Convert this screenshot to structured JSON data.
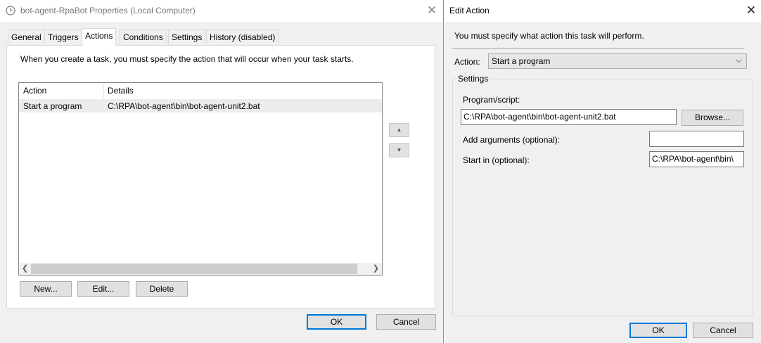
{
  "left_window": {
    "title": "bot-agent-RpaBot Properties (Local Computer)",
    "tabs": [
      "General",
      "Triggers",
      "Actions",
      "Conditions",
      "Settings",
      "History (disabled)"
    ],
    "active_tab": "Actions",
    "description": "When you create a task, you must specify the action that will occur when your task starts.",
    "table": {
      "columns": [
        "Action",
        "Details"
      ],
      "rows": [
        {
          "action": "Start a program",
          "details": "C:\\RPA\\bot-agent\\bin\\bot-agent-unit2.bat"
        }
      ]
    },
    "buttons": {
      "new": "New...",
      "edit": "Edit...",
      "delete": "Delete",
      "ok": "OK",
      "cancel": "Cancel"
    }
  },
  "right_window": {
    "title": "Edit Action",
    "instruction": "You must specify what action this task will perform.",
    "action_label": "Action:",
    "action_value": "Start a program",
    "settings_label": "Settings",
    "program_label": "Program/script:",
    "program_value": "C:\\RPA\\bot-agent\\bin\\bot-agent-unit2.bat",
    "browse_label": "Browse...",
    "arguments_label": "Add arguments (optional):",
    "arguments_value": "",
    "start_in_label": "Start in (optional):",
    "start_in_value": "C:\\RPA\\bot-agent\\bin\\",
    "ok_label": "OK",
    "cancel_label": "Cancel"
  },
  "icons": {
    "app": "clock-icon",
    "close": "close-icon",
    "move_up": "triangle-up-icon",
    "move_down": "triangle-down-icon",
    "scroll_left": "chevron-left-icon",
    "scroll_right": "chevron-right-icon",
    "dropdown": "chevron-down-icon"
  },
  "colors": {
    "default_button_border": "#0078d7",
    "selected_row": "#ececec"
  }
}
